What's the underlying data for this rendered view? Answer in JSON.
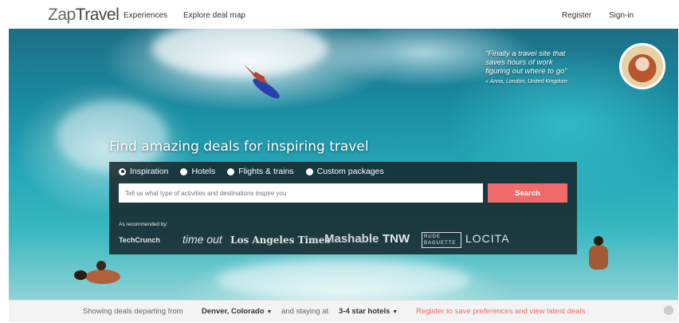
{
  "nav": {
    "logo_zap": "Zap",
    "logo_travel": "Travel",
    "experiences": "Experiences",
    "explore_deal_map": "Explore deal map",
    "register": "Register",
    "sign_in": "Sign-in"
  },
  "hero": {
    "quote_lines": [
      "“Finally a travel site that",
      "saves hours of work",
      "figuring out where to go”"
    ],
    "quote_author": "» Anna, London, United Kingdom",
    "headline": "Find amazing deals for inspiring travel"
  },
  "search": {
    "options": [
      "Inspiration",
      "Hotels",
      "Flights & trains",
      "Custom packages"
    ],
    "selected_option": "Inspiration",
    "placeholder": "Tell us what type of activities and destinations inspire you",
    "button_label": "Search"
  },
  "press": {
    "label": "As recommended by:",
    "logos": [
      "TechCrunch",
      "time out",
      "Los Angeles Times",
      "Mashable",
      "TNW",
      "RUDE BAGUETTE",
      "LOCITA"
    ]
  },
  "bottom_bar": {
    "text1": "Showing deals departing from",
    "city": "Denver, Colorado",
    "text2": "and staying at",
    "hotels": "3-4 star hotels",
    "cta": "Register to save preferences and view latest deals"
  },
  "colors": {
    "accent": "#f06a6a",
    "panel": "#141e23"
  }
}
